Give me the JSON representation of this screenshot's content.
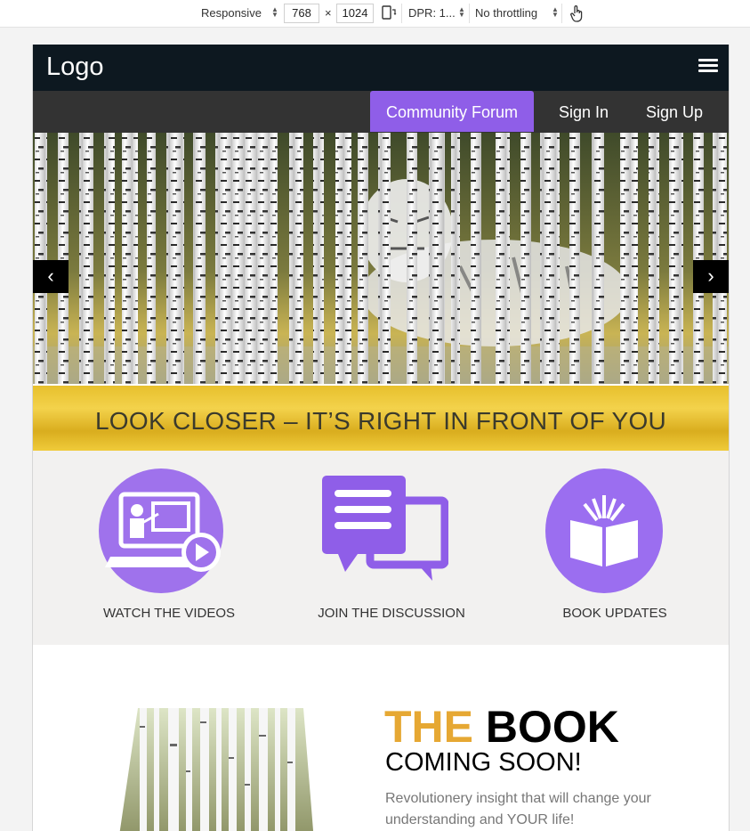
{
  "devtools": {
    "device": "Responsive",
    "width": "768",
    "height": "1024",
    "times": "×",
    "dpr": "DPR: 1...",
    "throttling": "No throttling"
  },
  "header": {
    "logo": "Logo"
  },
  "nav": {
    "forum": "Community Forum",
    "signin": "Sign In",
    "signup": "Sign Up"
  },
  "carousel": {
    "prev": "‹",
    "next": "›"
  },
  "tagline": "LOOK CLOSER – IT’S RIGHT IN FRONT OF YOU",
  "features": [
    {
      "label": "WATCH THE VIDEOS",
      "icon": "video-lesson-icon"
    },
    {
      "label": "JOIN THE DISCUSSION",
      "icon": "chat-bubbles-icon"
    },
    {
      "label": "BOOK UPDATES",
      "icon": "open-book-icon"
    }
  ],
  "book": {
    "title_the": "THE",
    "title_book": "BOOK",
    "subtitle": "COMING SOON!",
    "description": "Revolutionery insight that will change your understanding and YOUR life!"
  },
  "colors": {
    "accent": "#8f5ee8",
    "topbar": "#0d1820",
    "navbar": "#333333",
    "gold": "#e6a833"
  }
}
